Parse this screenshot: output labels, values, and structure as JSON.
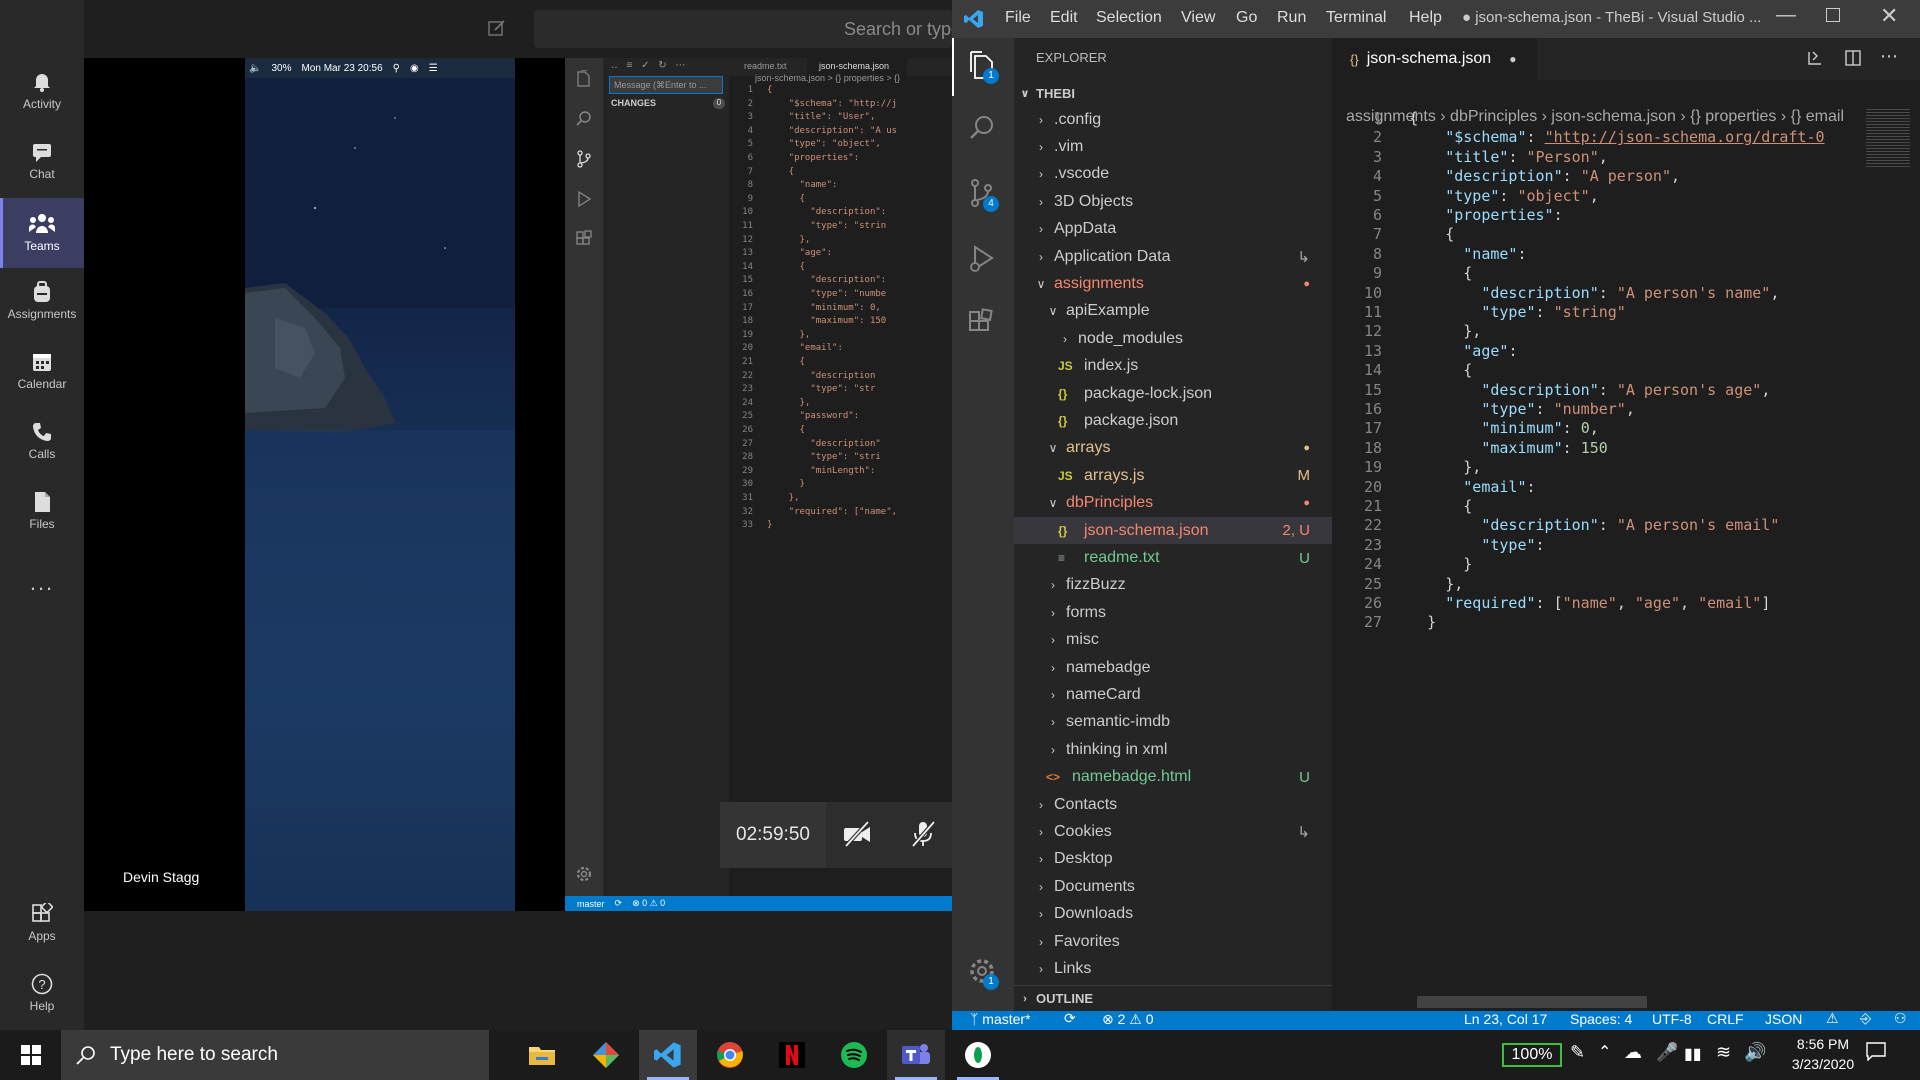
{
  "teams": {
    "search_placeholder": "Search or type",
    "rail": [
      {
        "label": "Activity",
        "icon": "bell-icon"
      },
      {
        "label": "Chat",
        "icon": "chat-icon"
      },
      {
        "label": "Teams",
        "icon": "teams-icon",
        "active": true
      },
      {
        "label": "Assignments",
        "icon": "backpack-icon"
      },
      {
        "label": "Calendar",
        "icon": "calendar-icon"
      },
      {
        "label": "Calls",
        "icon": "phone-icon"
      },
      {
        "label": "Files",
        "icon": "file-icon"
      },
      {
        "label": "Apps",
        "icon": "apps-icon"
      },
      {
        "label": "Help",
        "icon": "help-icon"
      }
    ],
    "more_label": "...",
    "speaker_name": "Devin Stagg",
    "call_timer": "02:59:50",
    "mac_menubar": {
      "battery": "30%",
      "datetime": "Mon Mar 23  20:56"
    }
  },
  "shared_vscode": {
    "tabs": [
      "readme.txt",
      "json-schema.json"
    ],
    "breadcrumb": "json-schema.json > {} properties > {}",
    "message_placeholder": "Message (⌘Enter to ...",
    "changes_label": "CHANGES",
    "changes_count": "0",
    "status_branch": "master",
    "status_problems": "⊗ 0 ⚠ 0",
    "code": [
      "{",
      "    \"$schema\": \"http://j",
      "    \"title\": \"User\",",
      "    \"description\": \"A us",
      "    \"type\": \"object\",",
      "    \"properties\":",
      "    {",
      "      \"name\":",
      "      {",
      "        \"description\":",
      "        \"type\": \"strin",
      "      },",
      "      \"age\":",
      "      {",
      "        \"description\":",
      "        \"type\": \"numbe",
      "        \"minimum\": 0,",
      "        \"maximum\": 150",
      "      },",
      "      \"email\":",
      "      {",
      "        \"description",
      "        \"type\": \"str",
      "      },",
      "      \"password\":",
      "      {",
      "        \"description\"",
      "        \"type\": \"stri",
      "        \"minLength\":",
      "      }",
      "    },",
      "    \"required\": [\"name\",",
      "}"
    ]
  },
  "vscode": {
    "menu": [
      "File",
      "Edit",
      "Selection",
      "View",
      "Go",
      "Run",
      "Terminal",
      "Help"
    ],
    "window_title": "● json-schema.json - TheBi - Visual Studio ...",
    "explorer_label": "EXPLORER",
    "workspace": "THEBI",
    "outline_label": "OUTLINE",
    "tab_title": "json-schema.json",
    "breadcrumb": [
      "assignments",
      "dbPrinciples",
      "json-schema.json",
      "{} properties",
      "{} email"
    ],
    "explorer_badge": "1",
    "scm_badge": "4",
    "settings_badge": "1",
    "tree": [
      {
        "label": ".config",
        "indent": 0,
        "kind": "folder",
        "open": false,
        "color": "#cccccc",
        "badge": ""
      },
      {
        "label": ".vim",
        "indent": 0,
        "kind": "folder",
        "open": false,
        "color": "#cccccc",
        "badge": ""
      },
      {
        "label": ".vscode",
        "indent": 0,
        "kind": "folder",
        "open": false,
        "color": "#cccccc",
        "badge": ""
      },
      {
        "label": "3D Objects",
        "indent": 0,
        "kind": "folder",
        "open": false,
        "color": "#cccccc",
        "badge": ""
      },
      {
        "label": "AppData",
        "indent": 0,
        "kind": "folder",
        "open": false,
        "color": "#cccccc",
        "badge": ""
      },
      {
        "label": "Application Data",
        "indent": 0,
        "kind": "folder",
        "open": false,
        "color": "#cccccc",
        "badge": "↳"
      },
      {
        "label": "assignments",
        "indent": 0,
        "kind": "folder",
        "open": true,
        "color": "#f48771",
        "badge": "●"
      },
      {
        "label": "apiExample",
        "indent": 1,
        "kind": "folder",
        "open": true,
        "color": "#cccccc",
        "badge": ""
      },
      {
        "label": "node_modules",
        "indent": 2,
        "kind": "folder",
        "open": false,
        "color": "#cccccc",
        "badge": ""
      },
      {
        "label": "index.js",
        "indent": 2,
        "kind": "js",
        "color": "#cccccc",
        "badge": ""
      },
      {
        "label": "package-lock.json",
        "indent": 2,
        "kind": "json",
        "color": "#cccccc",
        "badge": ""
      },
      {
        "label": "package.json",
        "indent": 2,
        "kind": "json",
        "color": "#cccccc",
        "badge": ""
      },
      {
        "label": "arrays",
        "indent": 1,
        "kind": "folder",
        "open": true,
        "color": "#e2c08d",
        "badge": "●"
      },
      {
        "label": "arrays.js",
        "indent": 2,
        "kind": "js",
        "color": "#e2c08d",
        "badge": "M"
      },
      {
        "label": "dbPrinciples",
        "indent": 1,
        "kind": "folder",
        "open": true,
        "color": "#f48771",
        "badge": "●"
      },
      {
        "label": "json-schema.json",
        "indent": 2,
        "kind": "json",
        "color": "#f48771",
        "badge": "2, U",
        "selected": true
      },
      {
        "label": "readme.txt",
        "indent": 2,
        "kind": "txt",
        "color": "#73c991",
        "badge": "U"
      },
      {
        "label": "fizzBuzz",
        "indent": 1,
        "kind": "folder",
        "open": false,
        "color": "#cccccc",
        "badge": ""
      },
      {
        "label": "forms",
        "indent": 1,
        "kind": "folder",
        "open": false,
        "color": "#cccccc",
        "badge": ""
      },
      {
        "label": "misc",
        "indent": 1,
        "kind": "folder",
        "open": false,
        "color": "#cccccc",
        "badge": ""
      },
      {
        "label": "namebadge",
        "indent": 1,
        "kind": "folder",
        "open": false,
        "color": "#cccccc",
        "badge": ""
      },
      {
        "label": "nameCard",
        "indent": 1,
        "kind": "folder",
        "open": false,
        "color": "#cccccc",
        "badge": ""
      },
      {
        "label": "semantic-imdb",
        "indent": 1,
        "kind": "folder",
        "open": false,
        "color": "#cccccc",
        "badge": ""
      },
      {
        "label": "thinking in xml",
        "indent": 1,
        "kind": "folder",
        "open": false,
        "color": "#cccccc",
        "badge": ""
      },
      {
        "label": "namebadge.html",
        "indent": 1,
        "kind": "html",
        "color": "#73c991",
        "badge": "U"
      },
      {
        "label": "Contacts",
        "indent": 0,
        "kind": "folder",
        "open": false,
        "color": "#cccccc",
        "badge": ""
      },
      {
        "label": "Cookies",
        "indent": 0,
        "kind": "folder",
        "open": false,
        "color": "#cccccc",
        "badge": "↳"
      },
      {
        "label": "Desktop",
        "indent": 0,
        "kind": "folder",
        "open": false,
        "color": "#cccccc",
        "badge": ""
      },
      {
        "label": "Documents",
        "indent": 0,
        "kind": "folder",
        "open": false,
        "color": "#cccccc",
        "badge": ""
      },
      {
        "label": "Downloads",
        "indent": 0,
        "kind": "folder",
        "open": false,
        "color": "#cccccc",
        "badge": ""
      },
      {
        "label": "Favorites",
        "indent": 0,
        "kind": "folder",
        "open": false,
        "color": "#cccccc",
        "badge": ""
      },
      {
        "label": "Links",
        "indent": 0,
        "kind": "folder",
        "open": false,
        "color": "#cccccc",
        "badge": ""
      }
    ],
    "code": [
      [
        [
          "p",
          "{"
        ]
      ],
      [
        [
          "p",
          "    "
        ],
        [
          "k",
          "\"$schema\""
        ],
        [
          "p",
          ": "
        ],
        [
          "u",
          "\"http://json-schema.org/draft-0"
        ]
      ],
      [
        [
          "p",
          "    "
        ],
        [
          "k",
          "\"title\""
        ],
        [
          "p",
          ": "
        ],
        [
          "s",
          "\"Person\""
        ],
        [
          "p",
          ","
        ]
      ],
      [
        [
          "p",
          "    "
        ],
        [
          "k",
          "\"description\""
        ],
        [
          "p",
          ": "
        ],
        [
          "s",
          "\"A person\""
        ],
        [
          "p",
          ","
        ]
      ],
      [
        [
          "p",
          "    "
        ],
        [
          "k",
          "\"type\""
        ],
        [
          "p",
          ": "
        ],
        [
          "s",
          "\"object\""
        ],
        [
          "p",
          ","
        ]
      ],
      [
        [
          "p",
          "    "
        ],
        [
          "k",
          "\"properties\""
        ],
        [
          "p",
          ":"
        ]
      ],
      [
        [
          "p",
          "    {"
        ]
      ],
      [
        [
          "p",
          "      "
        ],
        [
          "k",
          "\"name\""
        ],
        [
          "p",
          ":"
        ]
      ],
      [
        [
          "p",
          "      {"
        ]
      ],
      [
        [
          "p",
          "        "
        ],
        [
          "k",
          "\"description\""
        ],
        [
          "p",
          ": "
        ],
        [
          "s",
          "\"A person's name\""
        ],
        [
          "p",
          ","
        ]
      ],
      [
        [
          "p",
          "        "
        ],
        [
          "k",
          "\"type\""
        ],
        [
          "p",
          ": "
        ],
        [
          "s",
          "\"string\""
        ]
      ],
      [
        [
          "p",
          "      },"
        ]
      ],
      [
        [
          "p",
          "      "
        ],
        [
          "k",
          "\"age\""
        ],
        [
          "p",
          ":"
        ]
      ],
      [
        [
          "p",
          "      {"
        ]
      ],
      [
        [
          "p",
          "        "
        ],
        [
          "k",
          "\"description\""
        ],
        [
          "p",
          ": "
        ],
        [
          "s",
          "\"A person's age\""
        ],
        [
          "p",
          ","
        ]
      ],
      [
        [
          "p",
          "        "
        ],
        [
          "k",
          "\"type\""
        ],
        [
          "p",
          ": "
        ],
        [
          "s",
          "\"number\""
        ],
        [
          "p",
          ","
        ]
      ],
      [
        [
          "p",
          "        "
        ],
        [
          "k",
          "\"minimum\""
        ],
        [
          "p",
          ": "
        ],
        [
          "num",
          "0"
        ],
        [
          "p",
          ","
        ]
      ],
      [
        [
          "p",
          "        "
        ],
        [
          "k",
          "\"maximum\""
        ],
        [
          "p",
          ": "
        ],
        [
          "num",
          "150"
        ]
      ],
      [
        [
          "p",
          "      },"
        ]
      ],
      [
        [
          "p",
          "      "
        ],
        [
          "k",
          "\"email\""
        ],
        [
          "p",
          ":"
        ]
      ],
      [
        [
          "p",
          "      {"
        ]
      ],
      [
        [
          "p",
          "        "
        ],
        [
          "k",
          "\"description\""
        ],
        [
          "p",
          ": "
        ],
        [
          "s",
          "\"A person's email\""
        ]
      ],
      [
        [
          "p",
          "        "
        ],
        [
          "k",
          "\"type\""
        ],
        [
          "p",
          ":"
        ]
      ],
      [
        [
          "p",
          "      }"
        ]
      ],
      [
        [
          "p",
          "    },"
        ]
      ],
      [
        [
          "p",
          "    "
        ],
        [
          "k",
          "\"required\""
        ],
        [
          "p",
          ": ["
        ],
        [
          "s",
          "\"name\""
        ],
        [
          "p",
          ", "
        ],
        [
          "s",
          "\"age\""
        ],
        [
          "p",
          ", "
        ],
        [
          "s",
          "\"email\""
        ],
        [
          "p",
          "]"
        ]
      ],
      [
        [
          "p",
          "  }"
        ]
      ]
    ],
    "status": {
      "branch": "master*",
      "problems": "⊗ 2 ⚠ 0",
      "position": "Ln 23, Col 17",
      "spaces": "Spaces: 4",
      "encoding": "UTF-8",
      "eol": "CRLF",
      "language": "JSON"
    }
  },
  "taskbar": {
    "search_placeholder": "Type here to search",
    "apps": [
      "file-explorer-icon",
      "git-icon",
      "vscode-icon",
      "chrome-icon",
      "netflix-icon",
      "spotify-icon",
      "teams-icon",
      "app-icon"
    ],
    "battery": "100%",
    "time": "8:56 PM",
    "date": "3/23/2020"
  },
  "colors": {
    "accent": "#007acc",
    "teams_active": "#7b83eb",
    "modified": "#e2c08d",
    "error": "#f48771",
    "untracked": "#73c991"
  }
}
